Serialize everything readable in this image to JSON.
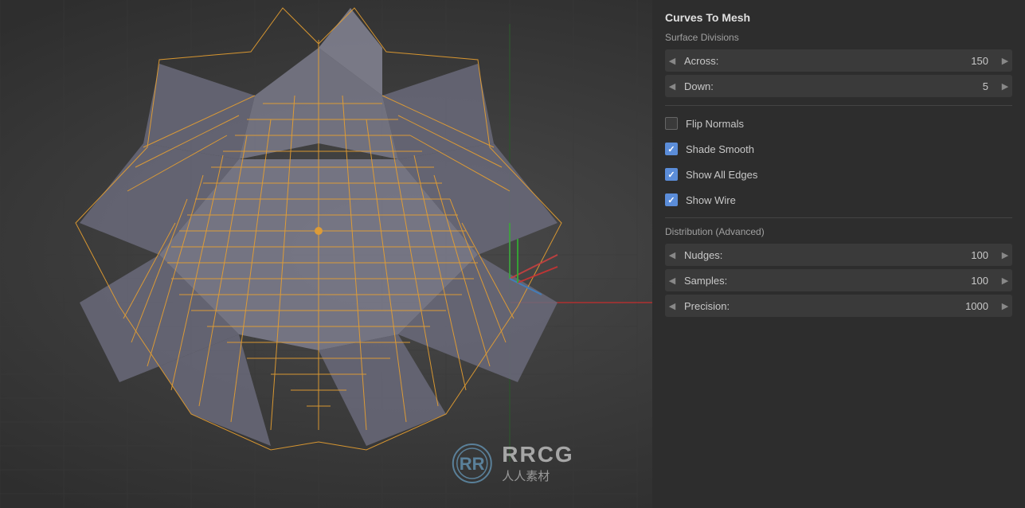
{
  "panel": {
    "title": "Curves To Mesh",
    "surface_divisions_label": "Surface Divisions",
    "across_label": "Across:",
    "across_value": "150",
    "down_label": "Down:",
    "down_value": "5",
    "flip_normals_label": "Flip Normals",
    "flip_normals_checked": false,
    "shade_smooth_label": "Shade Smooth",
    "shade_smooth_checked": true,
    "show_all_edges_label": "Show All Edges",
    "show_all_edges_checked": true,
    "show_wire_label": "Show Wire",
    "show_wire_checked": true,
    "distribution_label": "Distribution (Advanced)",
    "nudges_label": "Nudges:",
    "nudges_value": "100",
    "samples_label": "Samples:",
    "samples_value": "100",
    "precision_label": "Precision:",
    "precision_value": "1000"
  },
  "watermark": {
    "text_en": "RRCG",
    "text_cn": "人人素材"
  },
  "icons": {
    "arrow_left": "◀",
    "arrow_right": "▶"
  }
}
